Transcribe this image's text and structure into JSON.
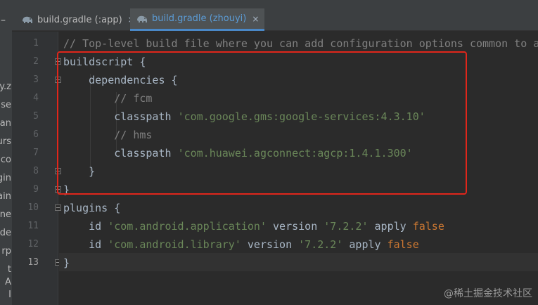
{
  "tabs": [
    {
      "label": "build.gradle (:app)",
      "active": false,
      "close": "×"
    },
    {
      "label": "build.gradle (zhouyi)",
      "active": true,
      "close": "×"
    }
  ],
  "side_panel": {
    "toggle_glyph": "–",
    "fragments": [
      "y.z",
      "se",
      "an",
      "urs",
      "co",
      "gin",
      "ain",
      "ne",
      "ode",
      "rp",
      "t",
      "A",
      "I"
    ]
  },
  "editor": {
    "current_line": 13,
    "lines": [
      {
        "n": "1",
        "parts": [
          {
            "t": "// Top-level build file where you can add configuration options common to all",
            "c": "cmt"
          }
        ]
      },
      {
        "n": "2",
        "parts": [
          {
            "t": "buildscript {",
            "c": "fn"
          }
        ]
      },
      {
        "n": "3",
        "parts": [
          {
            "t": "    dependencies {",
            "c": "fn"
          }
        ]
      },
      {
        "n": "4",
        "parts": [
          {
            "t": "        // fcm",
            "c": "cmt"
          }
        ]
      },
      {
        "n": "5",
        "parts": [
          {
            "t": "        classpath ",
            "c": "fn"
          },
          {
            "t": "'com.google.gms:google-services:4.3.10'",
            "c": "str"
          }
        ]
      },
      {
        "n": "6",
        "parts": [
          {
            "t": "        // hms",
            "c": "cmt"
          }
        ]
      },
      {
        "n": "7",
        "parts": [
          {
            "t": "        classpath ",
            "c": "fn"
          },
          {
            "t": "'com.huawei.agconnect:agcp:1.4.1.300'",
            "c": "str"
          }
        ]
      },
      {
        "n": "8",
        "parts": [
          {
            "t": "    }",
            "c": "fn"
          }
        ]
      },
      {
        "n": "9",
        "parts": [
          {
            "t": "}",
            "c": "fn"
          }
        ]
      },
      {
        "n": "10",
        "parts": [
          {
            "t": "plugins {",
            "c": "fn"
          }
        ]
      },
      {
        "n": "11",
        "parts": [
          {
            "t": "    id ",
            "c": "fn"
          },
          {
            "t": "'com.android.application'",
            "c": "str"
          },
          {
            "t": " version ",
            "c": "fn"
          },
          {
            "t": "'7.2.2'",
            "c": "str"
          },
          {
            "t": " apply ",
            "c": "fn"
          },
          {
            "t": "false",
            "c": "kw"
          }
        ]
      },
      {
        "n": "12",
        "parts": [
          {
            "t": "    id ",
            "c": "fn"
          },
          {
            "t": "'com.android.library'",
            "c": "str"
          },
          {
            "t": " version ",
            "c": "fn"
          },
          {
            "t": "'7.2.2'",
            "c": "str"
          },
          {
            "t": " apply ",
            "c": "fn"
          },
          {
            "t": "false",
            "c": "kw"
          }
        ]
      },
      {
        "n": "13",
        "parts": [
          {
            "t": "}",
            "c": "fn"
          }
        ]
      }
    ]
  },
  "watermark": "@稀土掘金技术社区",
  "colors": {
    "editor_bg": "#2b2b2b",
    "keyword": "#cc7832",
    "string": "#6a8759",
    "comment": "#808080",
    "highlight_border": "#e0261b",
    "active_tab_text": "#5b9bd5"
  },
  "icons": {
    "tab_icon": "gradle-elephant-icon"
  }
}
